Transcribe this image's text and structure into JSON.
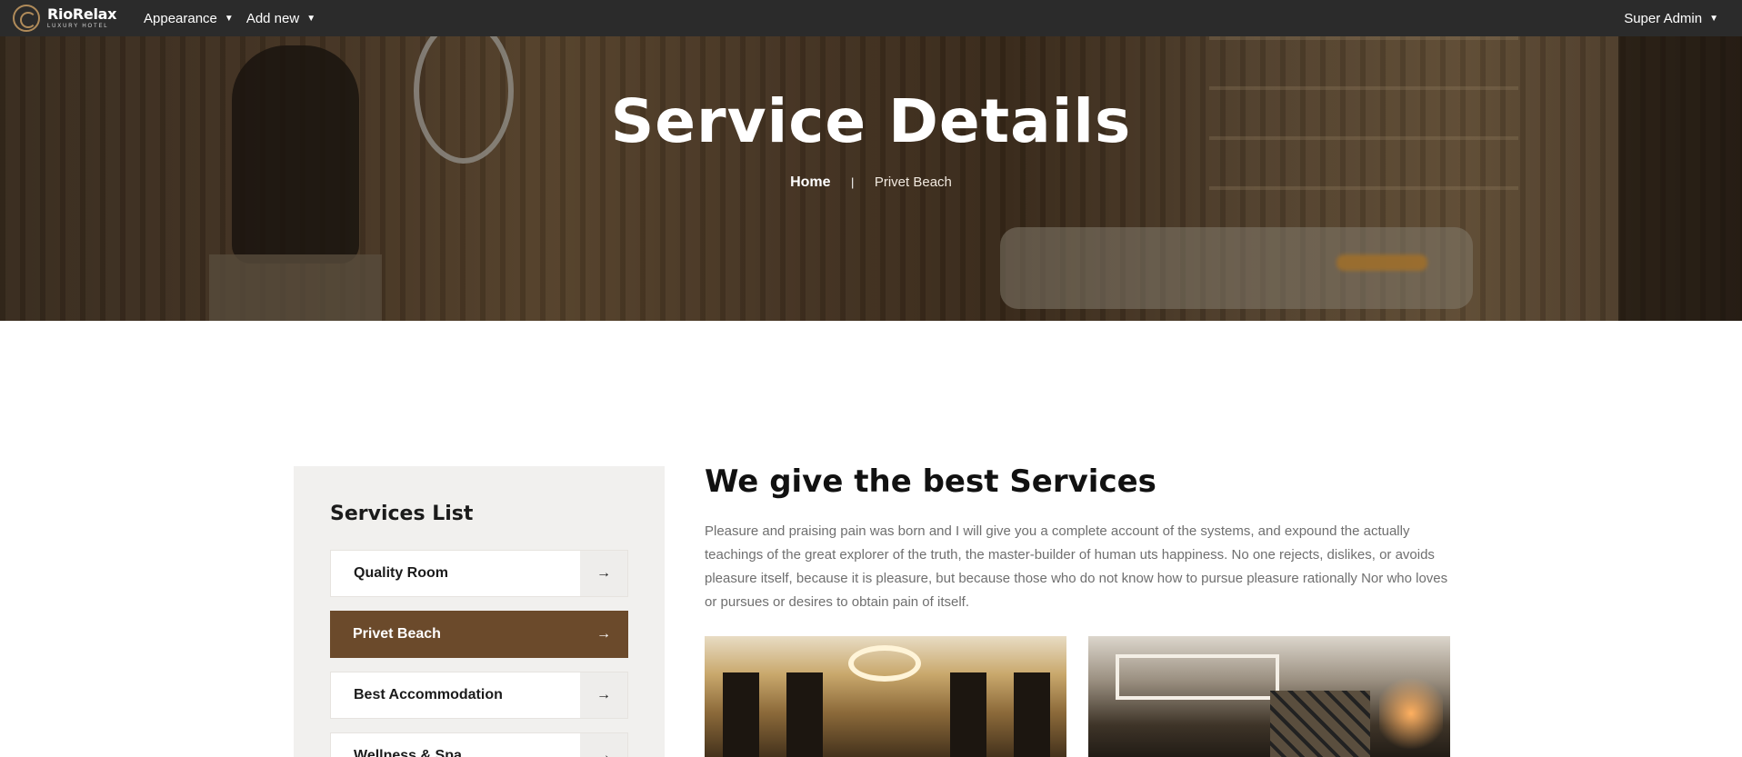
{
  "adminbar": {
    "brand_name": "RioRelax",
    "brand_tagline": "LUXURY HOTEL",
    "menu_appearance": "Appearance",
    "menu_add_new": "Add new",
    "menu_user": "Super Admin"
  },
  "hero": {
    "title": "Service Details",
    "breadcrumb_home": "Home",
    "breadcrumb_separator": "|",
    "breadcrumb_current": "Privet Beach"
  },
  "sidebar": {
    "title": "Services List",
    "items": [
      {
        "label": "Quality Room",
        "active": false
      },
      {
        "label": "Privet Beach",
        "active": true
      },
      {
        "label": "Best Accommodation",
        "active": false
      },
      {
        "label": "Wellness & Spa",
        "active": false
      }
    ],
    "arrow_icon": "arrow-right-icon"
  },
  "main": {
    "title": "We give the best Services",
    "paragraph": "Pleasure and praising pain was born and I will give you a complete account of the systems, and expound the actually teachings of the great explorer of the truth, the master-builder of human uts happiness. No one rejects, dislikes, or avoids pleasure itself, because it is pleasure, but because those who do not know how to pursue pleasure rationally Nor who loves or pursues or desires to obtain pain of itself."
  },
  "colors": {
    "adminbar_bg": "#2b2b2b",
    "accent_brown": "#6b4a2b",
    "sidebar_bg": "#f1f0ee"
  }
}
